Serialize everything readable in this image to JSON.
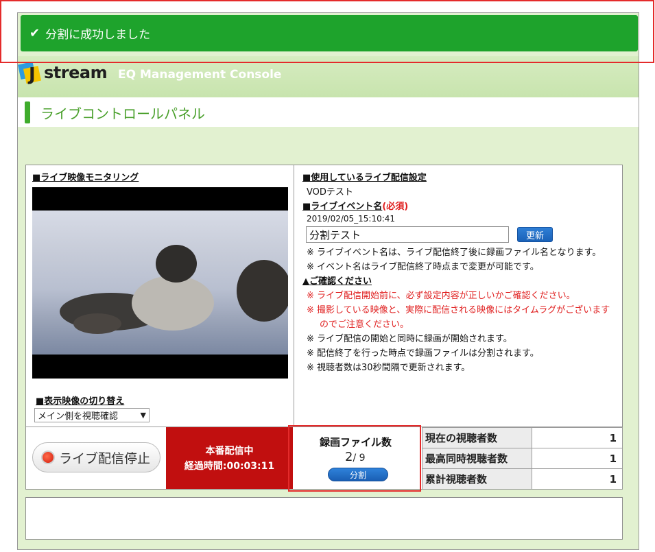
{
  "banner": {
    "check": "✔",
    "message": "分割に成功しました"
  },
  "header": {
    "logo_text": "stream",
    "logo_letter": "J",
    "app_title": "EQ Management Console"
  },
  "page": {
    "title": "ライブコントロールパネル"
  },
  "monitor": {
    "heading": "■ライブ映像モニタリング",
    "switch_heading": "■表示映像の切り替え",
    "switch_selected": "メイン側を視聴確認",
    "switch_arrow": "▼"
  },
  "settings": {
    "heading": "■使用しているライブ配信設定",
    "value": "VODテスト",
    "event_heading": "■ライブイベント名",
    "required": "(必須)",
    "timestamp": "2019/02/05_15:10:41",
    "event_name": "分割テスト",
    "update_label": "更新",
    "note1": "※ ライブイベント名は、ライブ配信終了後に録画ファイル名となります。",
    "note2": "※ イベント名はライブ配信終了時点まで変更が可能です。",
    "confirm_heading": "▲ご確認ください",
    "warn1": "※ ライブ配信開始前に、必ず設定内容が正しいかご確認ください。",
    "warn2a": "※ 撮影している映像と、実際に配信される映像にはタイムラグがございます",
    "warn2b": "のでご注意ください。",
    "info1": "※ ライブ配信の開始と同時に録画が開始されます。",
    "info2": "※ 配信終了を行った時点で録画ファイルは分割されます。",
    "info3": "※ 視聴者数は30秒間隔で更新されます。"
  },
  "controls": {
    "stop_label": "ライブ配信停止",
    "live_status": "本番配信中",
    "elapsed": "経過時間:00:03:11",
    "rec_title": "録画ファイル数",
    "rec_current": "2",
    "rec_total": "/ 9",
    "split_label": "分割"
  },
  "stats": [
    {
      "label": "現在の視聴者数",
      "value": "1"
    },
    {
      "label": "最高同時視聴者数",
      "value": "1"
    },
    {
      "label": "累計視聴者数",
      "value": "1"
    }
  ]
}
